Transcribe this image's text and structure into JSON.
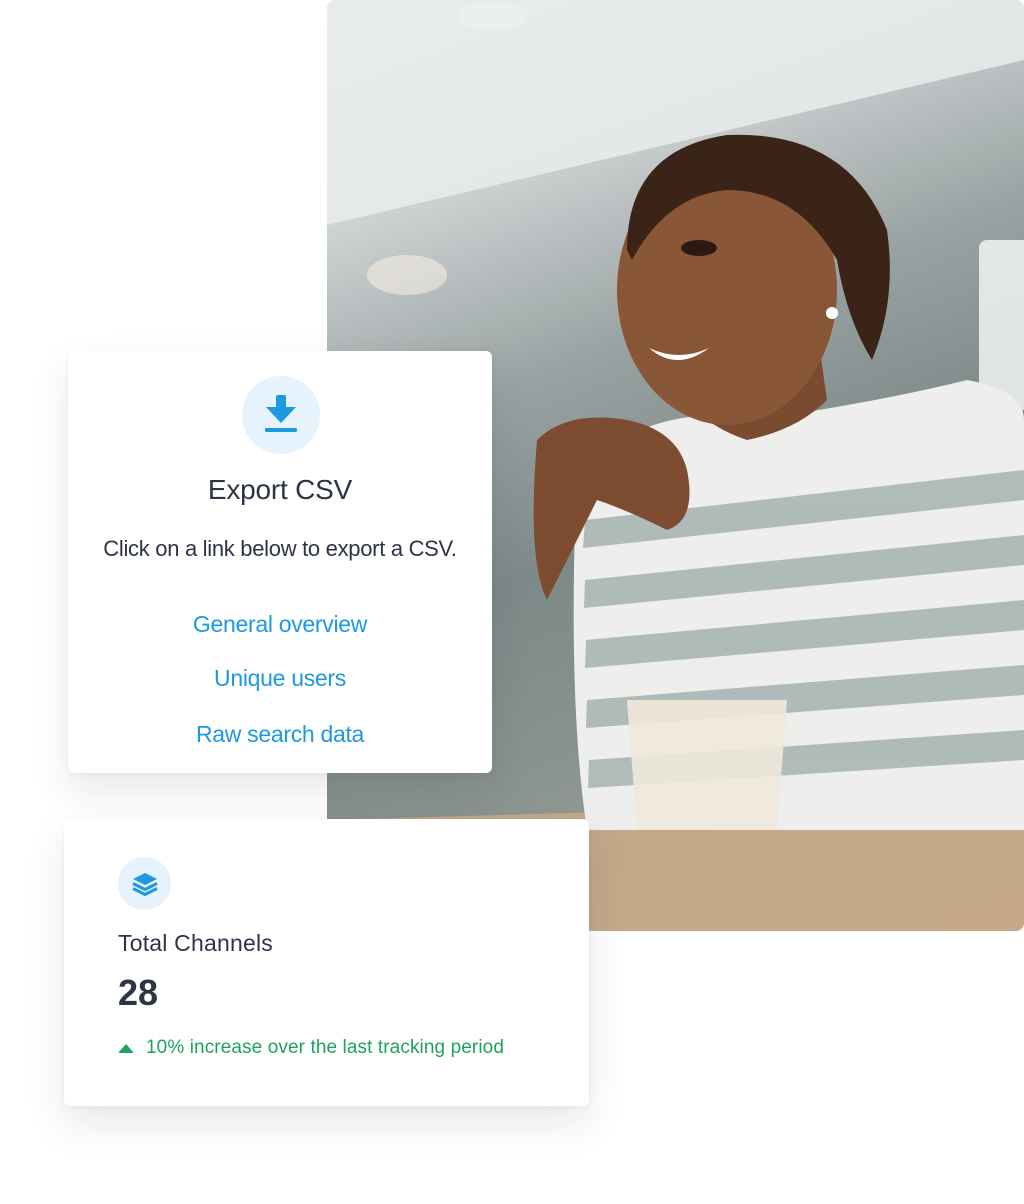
{
  "photo": {
    "icon": "woman-smiling-photo"
  },
  "export": {
    "icon": "download-icon",
    "title": "Export CSV",
    "description": "Click on a link below to export a CSV.",
    "links": [
      {
        "label": "General overview"
      },
      {
        "label": "Unique users"
      },
      {
        "label": "Raw search data"
      }
    ]
  },
  "stats": {
    "icon": "layers-icon",
    "label": "Total Channels",
    "value": "28",
    "trend_icon": "triangle-up-icon",
    "trend_text": "10% increase over the last tracking period"
  },
  "colors": {
    "link": "#1c99e0",
    "text": "#2c3445",
    "positive": "#1fa35c",
    "icon_bg": "#e6f3fd"
  }
}
